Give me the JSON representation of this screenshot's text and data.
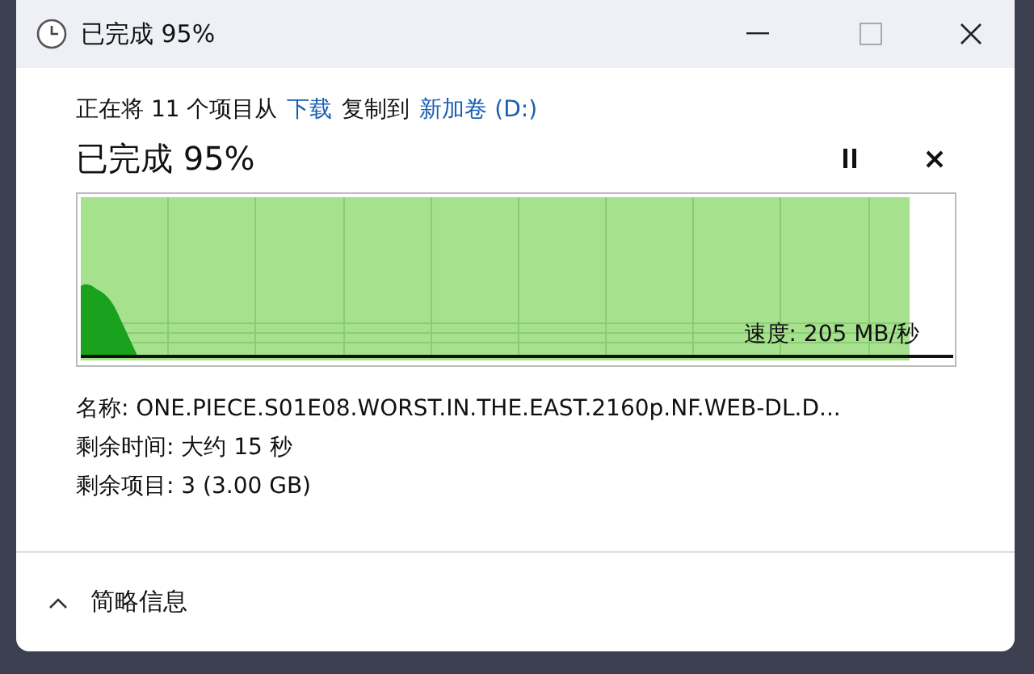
{
  "window": {
    "title": "已完成 95%"
  },
  "copy_line": [
    {
      "kind": "text",
      "text": "正在将 11 个项目从"
    },
    {
      "kind": "link",
      "text": "下载"
    },
    {
      "kind": "text",
      "text": "复制到"
    },
    {
      "kind": "link",
      "text": "新加卷 (D:)"
    }
  ],
  "progress": {
    "heading": "已完成 95%",
    "level": 0.95,
    "speed": "速度: 205 MB/秒"
  },
  "details": [
    "名称: ONE.PIECE.S01E08.WORST.IN.THE.EAST.2160p.NF.WEB-DL.D...",
    "剩余时间: 大约 15 秒",
    "剩余项目: 3 (3.00 GB)"
  ],
  "footer": {
    "toggle": "简略信息",
    "expanded": true
  }
}
